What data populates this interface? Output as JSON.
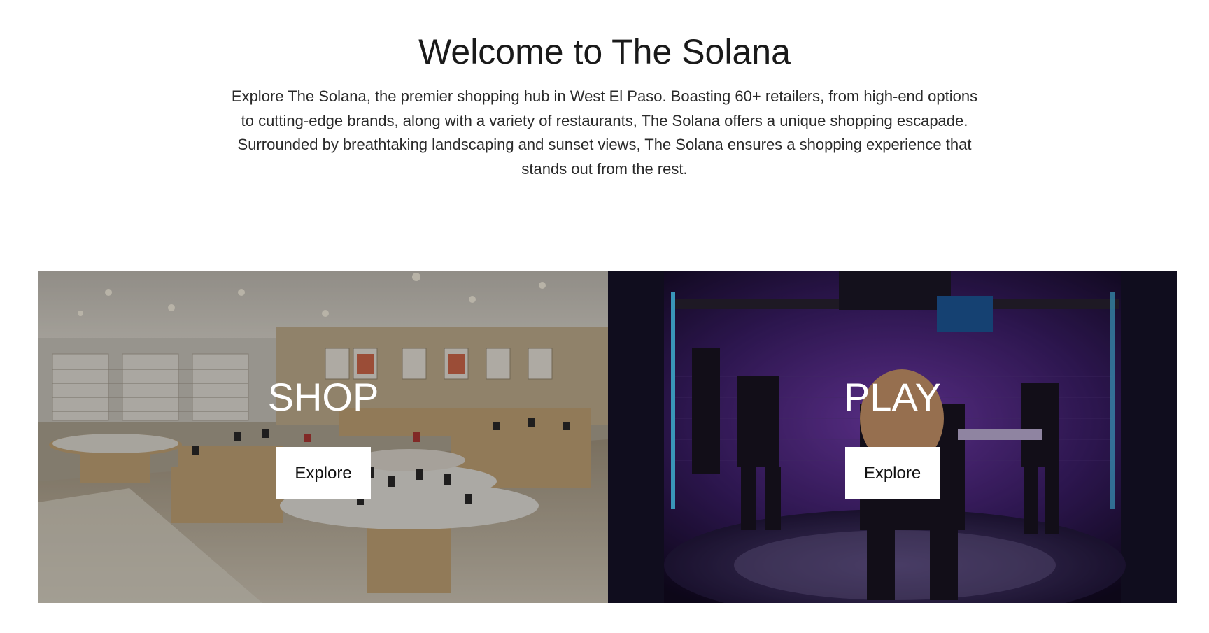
{
  "intro": {
    "heading": "Welcome to The Solana",
    "description": "Explore The Solana, the premier shopping hub in West El Paso. Boasting 60+ retailers, from high-end options to cutting-edge brands, along with a variety of restaurants, The Solana offers a unique shopping escapade. Surrounded by breathtaking landscaping and sunset views, The Solana ensures a shopping experience that stands out from the rest."
  },
  "tiles": [
    {
      "title": "SHOP",
      "button_label": "Explore",
      "image": "shoe-store-photo"
    },
    {
      "title": "PLAY",
      "button_label": "Explore",
      "image": "vr-arena-photo"
    }
  ],
  "colors": {
    "background": "#ffffff",
    "heading": "#1a1a1a",
    "button_bg": "#ffffff",
    "overlay_text": "#ffffff"
  }
}
